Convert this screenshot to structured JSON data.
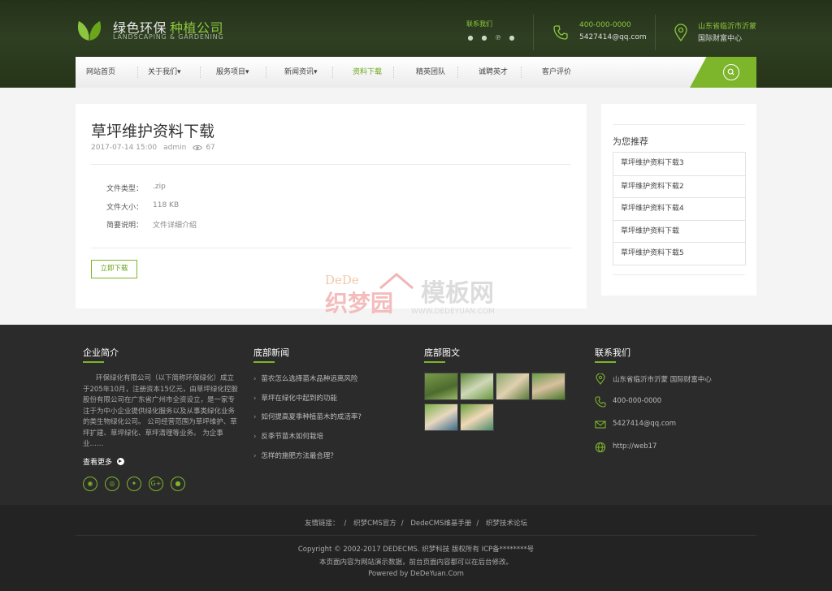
{
  "header": {
    "logo_title": "绿色环保",
    "logo_title_accent": "种植公司",
    "logo_subtitle": "LANDSCAPING & GARDENING",
    "contact_label": "联系我们",
    "phone_top": "400-000-0000",
    "email_top": "5427414@qq.com",
    "address_line1": "山东省临沂市沂蒙",
    "address_line2": "国际财富中心",
    "social_icons": [
      "weibo-icon",
      "qq-icon",
      "pinterest-icon",
      "wechat-icon"
    ]
  },
  "nav": {
    "items": [
      {
        "label": "网站首页",
        "active": false
      },
      {
        "label": "关于我们▾",
        "active": false
      },
      {
        "label": "服务项目▾",
        "active": false
      },
      {
        "label": "新闻资讯▾",
        "active": false
      },
      {
        "label": "资料下载",
        "active": true
      },
      {
        "label": "精英团队",
        "active": false
      },
      {
        "label": "诚聘英才",
        "active": false
      },
      {
        "label": "客户评价",
        "active": false
      }
    ],
    "accent_color": "#7db52b"
  },
  "article": {
    "title": "草坪维护资料下载",
    "date": "2017-07-14 15:00",
    "author": "admin",
    "views": "67",
    "fields": [
      {
        "label": "文件类型：",
        "value": ".zip"
      },
      {
        "label": "文件大小：",
        "value": "118 KB"
      },
      {
        "label": "简要说明：",
        "value": "文件详细介绍"
      }
    ],
    "download_label": "立即下载"
  },
  "watermark": {
    "line1": "DeDe",
    "brand": "织梦园",
    "site": "模板网",
    "url": "WWW.DEDEYUAN.COM"
  },
  "sidebar": {
    "title": "为您推荐",
    "items": [
      "草坪维护资料下载3",
      "草坪维护资料下载2",
      "草坪维护资料下载4",
      "草坪维护资料下载",
      "草坪维护资料下载5"
    ]
  },
  "footer": {
    "intro_title": "企业简介",
    "intro_text": "环保绿化有限公司（以下简称环保绿化）成立于205年10月，注册资本15亿元，由草坪绿化控股股份有限公司在广东省广州市全资设立，是一家专注于为中小企业提供绿化服务以及从事类绿化业务的类生物绿化公司。 公司经营范围为草坪维护、草坪扩建、草坪绿化、草坪清理等业务。 为企事业……",
    "more_label": "查看更多",
    "news_title": "底部新闻",
    "news": [
      "苗农怎么选择苗木品种远离风险",
      "草坪在绿化中起到的功能",
      "如何提高夏季种植苗木的成活率?",
      "反季节苗木如何栽培",
      "怎样的施肥方法最合理？"
    ],
    "gallery_title": "底部图文",
    "contact_title": "联系我们",
    "contact_address": "山东省临沂市沂蒙 国际财富中心",
    "contact_phone": "400-000-0000",
    "contact_email": "5427414@qq.com",
    "contact_web": "http://web17",
    "social_icons": [
      "qq-icon",
      "weibo-icon",
      "twitter-icon",
      "google-plus-icon",
      "wechat-icon"
    ]
  },
  "bottom": {
    "links_label": "友情链接：",
    "links": [
      "织梦CMS官方",
      "DedeCMS维基手册",
      "织梦技术论坛"
    ],
    "copyright": "Copyright © 2002-2017 DEDECMS. 织梦科技 版权所有 ICP备********号",
    "notice": "本页面内容为网站演示数据，前台页面内容都可以在后台修改。",
    "powered": "Powered by DeDeYuan.Com"
  }
}
